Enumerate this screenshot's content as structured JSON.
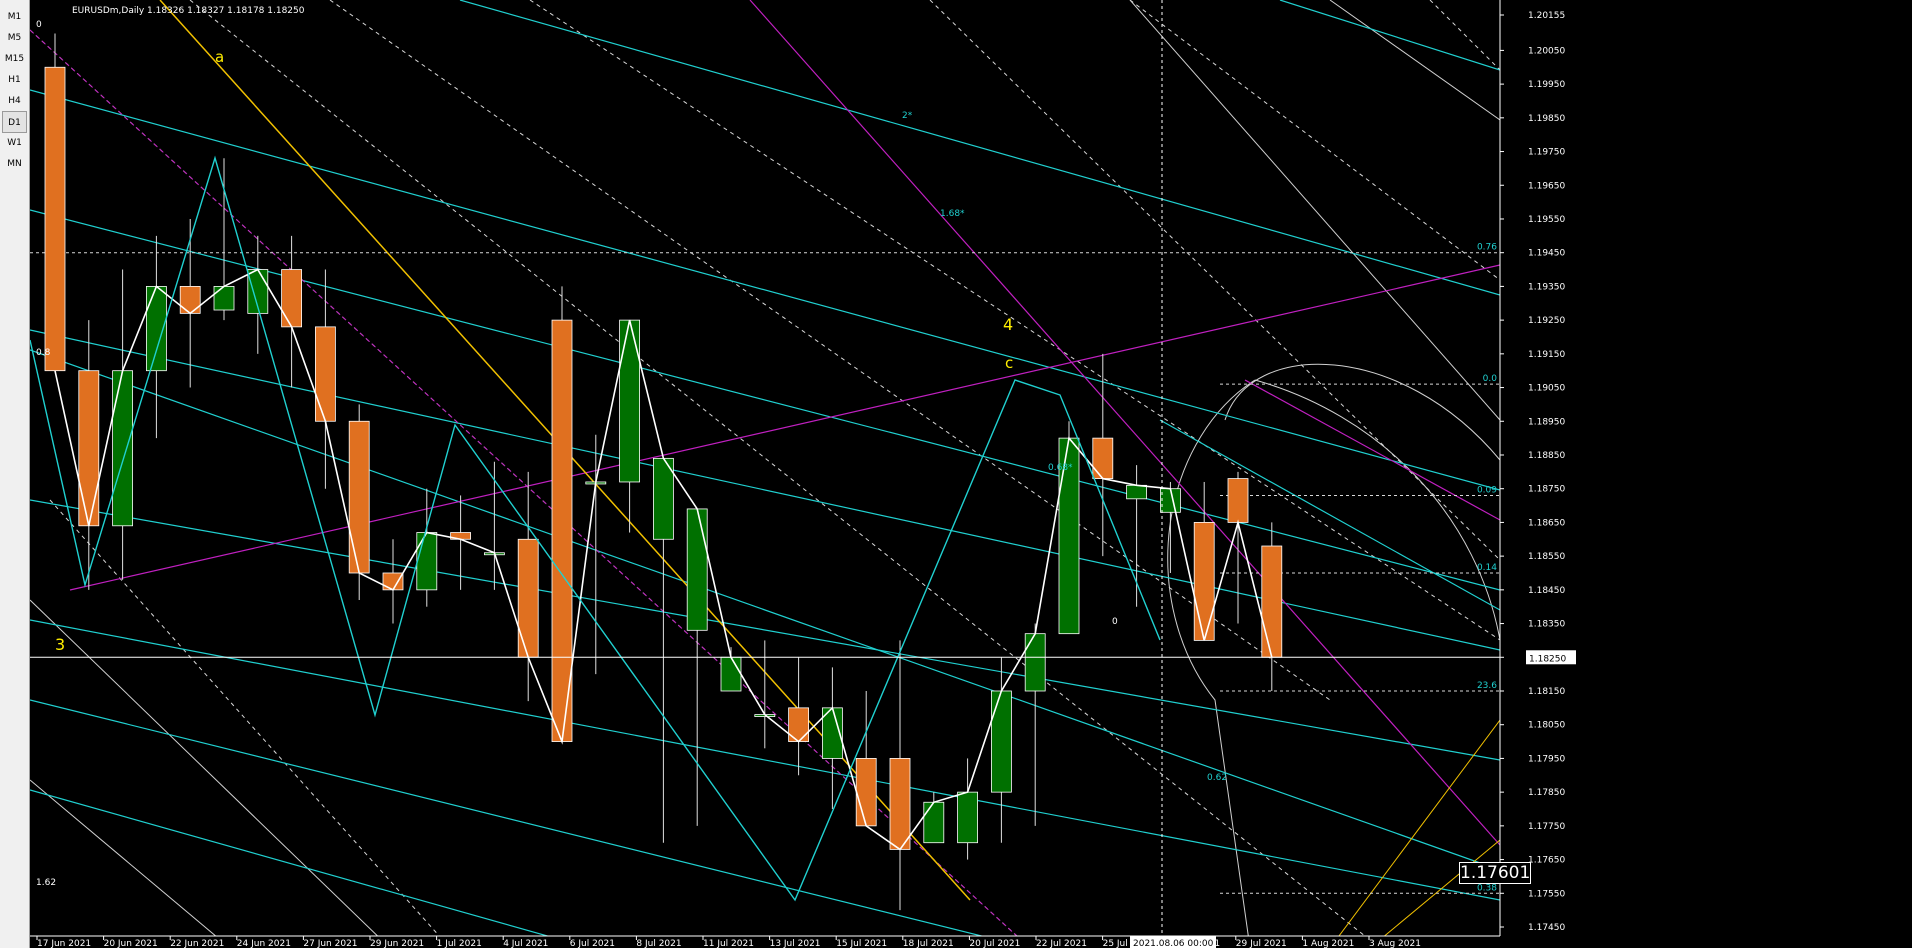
{
  "timeframes": [
    "M1",
    "M5",
    "M15",
    "H1",
    "H4",
    "D1",
    "W1",
    "MN"
  ],
  "active_timeframe": "D1",
  "symbol_line": "EURUSDm,Daily  1.18326 1.18327 1.18178 1.18250",
  "price_axis": [
    "1.20155",
    "1.20050",
    "1.19950",
    "1.19850",
    "1.19750",
    "1.19650",
    "1.19550",
    "1.19450",
    "1.19350",
    "1.19250",
    "1.19150",
    "1.19050",
    "1.18950",
    "1.18850",
    "1.18750",
    "1.18650",
    "1.18550",
    "1.18450",
    "1.18350",
    "1.18250",
    "1.18150",
    "1.18050",
    "1.17950",
    "1.17850",
    "1.17750",
    "1.17650",
    "1.17550",
    "1.17450"
  ],
  "current_price": "1.18250",
  "date_axis": [
    "17 Jun 2021",
    "20 Jun 2021",
    "22 Jun 2021",
    "24 Jun 2021",
    "27 Jun 2021",
    "29 Jun 2021",
    "1 Jul 2021",
    "4 Jul 2021",
    "6 Jul 2021",
    "8 Jul 2021",
    "11 Jul 2021",
    "13 Jul 2021",
    "15 Jul 2021",
    "18 Jul 2021",
    "20 Jul 2021",
    "22 Jul 2021",
    "25 Jul 2021",
    "27 Jul 2021",
    "29 Jul 2021",
    "1 Aug 2021",
    "3 Aug 2021"
  ],
  "crosshair_date": "2021.08.06 00:00",
  "crosshair_price": "1.17601",
  "wave_labels": [
    "a",
    "3",
    "4",
    "c"
  ],
  "fib_level_labels": [
    "0.76",
    "0.0",
    "0.09",
    "0.14",
    "23.6",
    "0.62",
    "0.38"
  ],
  "fan_labels": [
    "2*",
    "1.68*",
    "0.68*",
    "1.62",
    "0"
  ],
  "corner_labels": [
    "0",
    "0.8"
  ],
  "colors": {
    "bullish": "#007000",
    "bearish": "#e07020",
    "fan": "#20d0d0",
    "pitchfork": "#c020c0",
    "trend": "#f0c000",
    "wave_label": "#ffee00",
    "grid": "#ffffff"
  },
  "chart_data": {
    "type": "candlestick",
    "x": [
      "17 Jun 2021",
      "18 Jun 2021",
      "21 Jun 2021",
      "22 Jun 2021",
      "23 Jun 2021",
      "24 Jun 2021",
      "25 Jun 2021",
      "28 Jun 2021",
      "29 Jun 2021",
      "30 Jun 2021",
      "1 Jul 2021",
      "2 Jul 2021",
      "5 Jul 2021",
      "6 Jul 2021",
      "7 Jul 2021",
      "8 Jul 2021",
      "9 Jul 2021",
      "12 Jul 2021",
      "13 Jul 2021",
      "14 Jul 2021",
      "15 Jul 2021",
      "16 Jul 2021",
      "19 Jul 2021",
      "20 Jul 2021",
      "21 Jul 2021",
      "22 Jul 2021",
      "23 Jul 2021",
      "26 Jul 2021",
      "27 Jul 2021",
      "28 Jul 2021",
      "29 Jul 2021",
      "30 Jul 2021",
      "2 Aug 2021",
      "3 Aug 2021",
      "4 Aug 2021",
      "5 Aug 2021",
      "6 Aug 2021"
    ],
    "open": [
      1.2,
      1.191,
      1.1864,
      1.191,
      1.1935,
      1.1928,
      1.1927,
      1.194,
      1.1923,
      1.1895,
      1.185,
      1.1845,
      1.1862,
      1.1856,
      1.186,
      1.1925,
      1.1877,
      1.1877,
      1.186,
      1.1833,
      1.1815,
      1.1808,
      1.181,
      1.1795,
      1.1795,
      1.1795,
      1.177,
      1.177,
      1.1785,
      1.1815,
      1.1832,
      1.189,
      1.1872,
      1.1868,
      1.1865,
      1.1878,
      1.1858
    ],
    "high": [
      1.201,
      1.1925,
      1.194,
      1.195,
      1.1955,
      1.1973,
      1.195,
      1.195,
      1.194,
      1.19,
      1.186,
      1.1875,
      1.1873,
      1.1883,
      1.188,
      1.1935,
      1.1891,
      1.1883,
      1.1875,
      1.1843,
      1.1828,
      1.183,
      1.1825,
      1.1822,
      1.1815,
      1.183,
      1.1785,
      1.1795,
      1.1825,
      1.1835,
      1.1895,
      1.1915,
      1.1882,
      1.1877,
      1.1877,
      1.188,
      1.1865
    ],
    "high_wicks": [
      1.201,
      1.1927,
      1.1942,
      1.1952,
      1.1955,
      1.1973,
      1.195,
      1.195,
      1.194,
      1.19,
      1.186,
      1.1875,
      1.1873,
      1.1883,
      1.188,
      1.1935,
      1.1891,
      1.1883,
      1.1875,
      1.1843,
      1.1828,
      1.183,
      1.1825,
      1.1822,
      1.1815,
      1.183,
      1.1785,
      1.1795,
      1.1825,
      1.1835,
      1.1895,
      1.1915,
      1.1882,
      1.1877,
      1.1877,
      1.188,
      1.1865
    ],
    "low": [
      1.191,
      1.1845,
      1.1848,
      1.189,
      1.1905,
      1.1925,
      1.1915,
      1.1905,
      1.1875,
      1.1842,
      1.1835,
      1.184,
      1.1845,
      1.1845,
      1.1812,
      1.18,
      1.182,
      1.1862,
      1.177,
      1.1775,
      1.1815,
      1.1798,
      1.179,
      1.178,
      1.1785,
      1.175,
      1.177,
      1.1765,
      1.177,
      1.1775,
      1.1835,
      1.1855,
      1.184,
      1.185,
      1.184,
      1.1835,
      1.1815
    ],
    "close": [
      1.191,
      1.1864,
      1.191,
      1.1935,
      1.1927,
      1.1935,
      1.194,
      1.1923,
      1.1895,
      1.185,
      1.1845,
      1.1862,
      1.186,
      1.1856,
      1.1825,
      1.18,
      1.1877,
      1.1925,
      1.1884,
      1.1869,
      1.1825,
      1.1808,
      1.18,
      1.181,
      1.1775,
      1.1768,
      1.1782,
      1.1785,
      1.1815,
      1.1832,
      1.189,
      1.1878,
      1.1876,
      1.1875,
      1.183,
      1.1865,
      1.1825
    ],
    "ylim": [
      1.1745,
      1.202
    ],
    "grid": false
  }
}
